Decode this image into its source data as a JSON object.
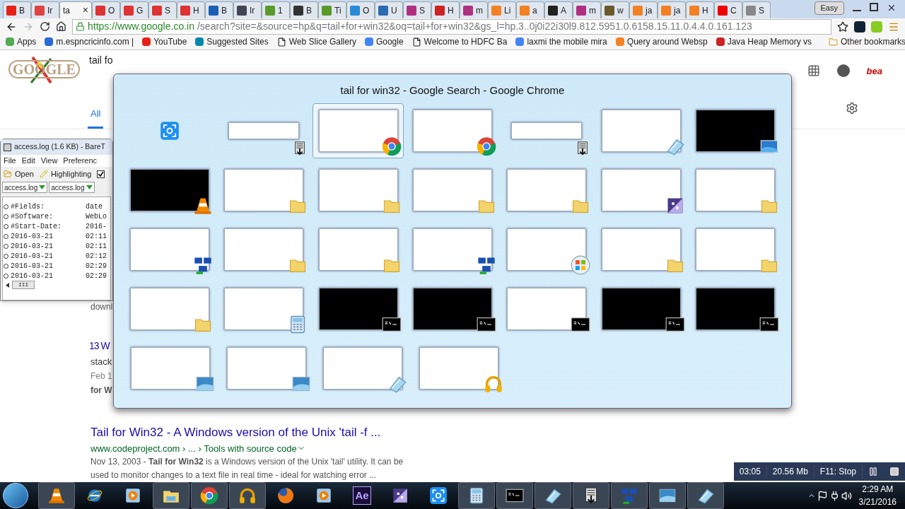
{
  "browser_tabs": [
    {
      "label": "B",
      "kind": "youtube",
      "selected": false
    },
    {
      "label": "Ir",
      "kind": "gmail",
      "selected": false
    },
    {
      "label": "ta",
      "kind": "blank",
      "selected": true,
      "close": "×"
    },
    {
      "label": "O",
      "kind": "my",
      "selected": false
    },
    {
      "label": "G",
      "kind": "my",
      "selected": false
    },
    {
      "label": "S",
      "kind": "my",
      "selected": false
    },
    {
      "label": "H",
      "kind": "my",
      "selected": false
    },
    {
      "label": "B",
      "kind": "sd",
      "selected": false
    },
    {
      "label": "Ir",
      "kind": "dark",
      "selected": false
    },
    {
      "label": "1",
      "kind": "green",
      "selected": false
    },
    {
      "label": "B",
      "kind": "grid",
      "selected": false
    },
    {
      "label": "Ti",
      "kind": "green",
      "selected": false
    },
    {
      "label": "O",
      "kind": "blue",
      "selected": false
    },
    {
      "label": "U",
      "kind": "sf",
      "selected": false
    },
    {
      "label": "S",
      "kind": "feather",
      "selected": false
    },
    {
      "label": "H",
      "kind": "bars",
      "selected": false
    },
    {
      "label": "m",
      "kind": "feather",
      "selected": false
    },
    {
      "label": "Li",
      "kind": "stack",
      "selected": false
    },
    {
      "label": "a",
      "kind": "stack",
      "selected": false
    },
    {
      "label": "A",
      "kind": "penguin",
      "selected": false
    },
    {
      "label": "m",
      "kind": "feather",
      "selected": false
    },
    {
      "label": "w",
      "kind": "horseshoe",
      "selected": false
    },
    {
      "label": "ja",
      "kind": "stack",
      "selected": false
    },
    {
      "label": "ja",
      "kind": "stack",
      "selected": false
    },
    {
      "label": "H",
      "kind": "stack",
      "selected": false
    },
    {
      "label": "C",
      "kind": "oracle",
      "selected": false
    },
    {
      "label": "S",
      "kind": "page",
      "selected": false
    }
  ],
  "profile_badge": "Easy",
  "address": {
    "host": "https://www.google.co.in",
    "path": "/search?site=&source=hp&q=tail+for+win32&oq=tail+for+win32&gs_l=hp.3..0j0i22i30l9.812.5951.0.6158.15.11.0.4.4.0.161.123"
  },
  "bookmarks": [
    {
      "label": "Apps",
      "kind": "apps"
    },
    {
      "label": "m.espncricinfo.com |",
      "kind": "c"
    },
    {
      "label": "YouTube",
      "kind": "youtube"
    },
    {
      "label": "Suggested Sites",
      "kind": "bing"
    },
    {
      "label": "Web Slice Gallery",
      "kind": "page"
    },
    {
      "label": "Google",
      "kind": "google"
    },
    {
      "label": "Welcome to HDFC Ba",
      "kind": "page"
    },
    {
      "label": "laxmi the mobile mira",
      "kind": "google"
    },
    {
      "label": "Query around Websp",
      "kind": "stack"
    },
    {
      "label": "Java Heap Memory vs",
      "kind": "java"
    }
  ],
  "other_bookmarks": "Other bookmarks",
  "google": {
    "logo": "GOOGLE",
    "query": "tail fo",
    "tabs": [
      {
        "label": "All",
        "selected": true
      }
    ],
    "account_logo": "bea",
    "partial_results": [
      {
        "kind": "snippet",
        "text": "downl"
      },
      {
        "kind": "title",
        "text": "13 W"
      },
      {
        "kind": "url",
        "text": "stack"
      },
      {
        "kind": "date",
        "text": "Feb 1"
      },
      {
        "kind": "bold",
        "text": "for W"
      }
    ],
    "result": {
      "title": "Tail for Win32 - A Windows version of the Unix 'tail -f ...",
      "url": "www.codeproject.com › ... › Tools with source code",
      "snippet": "Nov 13, 2003 - **Tail for Win32** is a Windows version of the Unix 'tail' utility. It can be used to monitor changes to a text file in real time - ideal for watching error ..."
    }
  },
  "baretail": {
    "title": "access.log (1.6 KB) - BareT",
    "menu": [
      "File",
      "Edit",
      "View",
      "Preferenc"
    ],
    "toolbar": [
      {
        "label": "Open",
        "kind": "open"
      },
      {
        "label": "Highlighting",
        "kind": "highlight"
      }
    ],
    "follow_checked": true,
    "tabs": [
      "access.log",
      "access.log"
    ],
    "lines": [
      [
        "#Fields:",
        "date"
      ],
      [
        "#Software:",
        "WebLo"
      ],
      [
        "#Start-Date:",
        "2016-"
      ],
      [
        "2016-03-21",
        "02:11"
      ],
      [
        "2016-03-21",
        "02:11"
      ],
      [
        "2016-03-21",
        "02:12"
      ],
      [
        "2016-03-21",
        "02:29"
      ],
      [
        "2016-03-21",
        "02:29"
      ]
    ],
    "scroll_thumb": "III"
  },
  "switcher": {
    "title": "tail for win32 - Google Search - Google Chrome",
    "rows": [
      [
        {
          "kind": "capture",
          "selected": false
        },
        {
          "kind": "baretail",
          "selected": false
        },
        {
          "kind": "chrome",
          "selected": true
        },
        {
          "kind": "chrome",
          "selected": false
        },
        {
          "kind": "baretail",
          "selected": false
        },
        {
          "kind": "notepad",
          "selected": false
        },
        {
          "kind": "desktop",
          "selected": false
        }
      ],
      [
        {
          "kind": "vlc",
          "selected": false
        },
        {
          "kind": "folder",
          "selected": false
        },
        {
          "kind": "folder",
          "selected": false
        },
        {
          "kind": "folder",
          "selected": false
        },
        {
          "kind": "folder",
          "selected": false
        },
        {
          "kind": "paint",
          "selected": false
        },
        {
          "kind": "folder",
          "selected": false
        }
      ],
      [
        {
          "kind": "network",
          "selected": false
        },
        {
          "kind": "folder",
          "selected": false
        },
        {
          "kind": "folder",
          "selected": false
        },
        {
          "kind": "network",
          "selected": false
        },
        {
          "kind": "windows",
          "selected": false
        },
        {
          "kind": "folder",
          "selected": false
        },
        {
          "kind": "folder",
          "selected": false
        }
      ],
      [
        {
          "kind": "folder",
          "selected": false
        },
        {
          "kind": "calculator",
          "selected": false
        },
        {
          "kind": "cmd",
          "selected": false
        },
        {
          "kind": "cmd",
          "selected": false
        },
        {
          "kind": "console",
          "selected": false
        },
        {
          "kind": "cmd",
          "selected": false
        },
        {
          "kind": "cmd",
          "selected": false
        }
      ],
      [
        {
          "kind": "pictures",
          "selected": false
        },
        {
          "kind": "pictures",
          "selected": false
        },
        {
          "kind": "notepad",
          "selected": false
        },
        {
          "kind": "audio",
          "selected": false
        }
      ]
    ]
  },
  "recorder": {
    "time": "03:05",
    "size": "20.56 Mb",
    "hotkey": "F11: Stop"
  },
  "taskbar": {
    "apps": [
      {
        "kind": "vlc",
        "running": true
      },
      {
        "kind": "ie",
        "running": false
      },
      {
        "kind": "media",
        "running": false
      },
      {
        "kind": "explorer",
        "running": true
      },
      {
        "kind": "chrome",
        "running": true
      },
      {
        "kind": "audio",
        "running": true
      },
      {
        "kind": "firefox",
        "running": false
      },
      {
        "kind": "media",
        "running": false
      },
      {
        "kind": "ae",
        "running": false,
        "label": "Ae"
      },
      {
        "kind": "paint",
        "running": false
      },
      {
        "kind": "capture",
        "running": false
      },
      {
        "kind": "calculator",
        "running": true
      },
      {
        "kind": "cmd",
        "running": true
      },
      {
        "kind": "notepad",
        "running": true
      },
      {
        "kind": "baretail",
        "running": true
      },
      {
        "kind": "network",
        "running": true
      },
      {
        "kind": "pictures",
        "running": true
      },
      {
        "kind": "notepad",
        "running": true
      }
    ],
    "time": "2:29 AM",
    "date": "3/21/2016"
  }
}
